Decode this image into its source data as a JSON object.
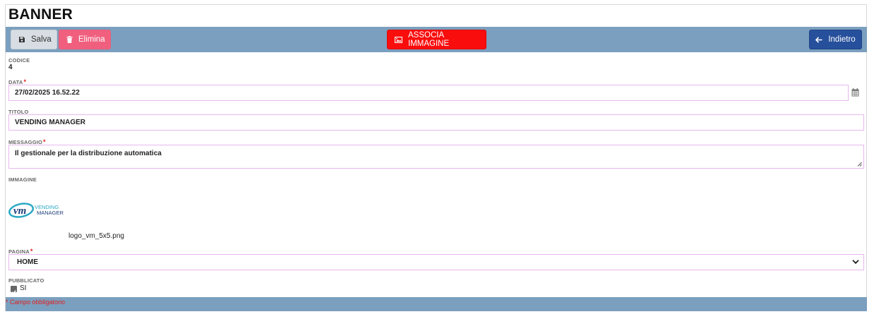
{
  "page": {
    "title": "BANNER"
  },
  "toolbar": {
    "save_label": "Salva",
    "delete_label": "Elimina",
    "associate_image_label": "ASSOCIA IMMAGINE",
    "back_label": "Indietro"
  },
  "form": {
    "codice": {
      "label": "CODICE",
      "value": "4"
    },
    "data": {
      "label": "DATA",
      "required": "*",
      "value": "27/02/2025 16.52.22"
    },
    "titolo": {
      "label": "TITOLO",
      "value": "VENDING MANAGER"
    },
    "messaggio": {
      "label": "MESSAGGIO",
      "required": "*",
      "value": "Il gestionale per la distribuzione automatica"
    },
    "immagine": {
      "label": "IMMAGINE",
      "filename": "logo_vm_5x5.png",
      "logo_text_1": "VENDING",
      "logo_text_2": "MANAGER"
    },
    "pagina": {
      "label": "PAGINA",
      "required": "*",
      "selected": "HOME"
    },
    "pubblicato": {
      "label": "PUBBLICATO",
      "checked": true,
      "option_label": "SI"
    }
  },
  "footer": {
    "required_note": "* Campo obbligatorio"
  },
  "colors": {
    "toolbar_bg": "#7b9fbe",
    "save_bg": "#d7dde3",
    "delete_bg": "#f0607e",
    "associate_bg": "#f90d0d",
    "back_bg": "#26509b",
    "field_border": "#e7b8ee",
    "required": "#e02020"
  },
  "icons": {
    "save": "floppy-disk-icon",
    "delete": "trash-icon",
    "associate": "image-icon",
    "back": "arrow-left-icon",
    "calendar": "calendar-icon",
    "select": "chevron-down-icon",
    "checkbox": "checkbox-checked-icon"
  }
}
